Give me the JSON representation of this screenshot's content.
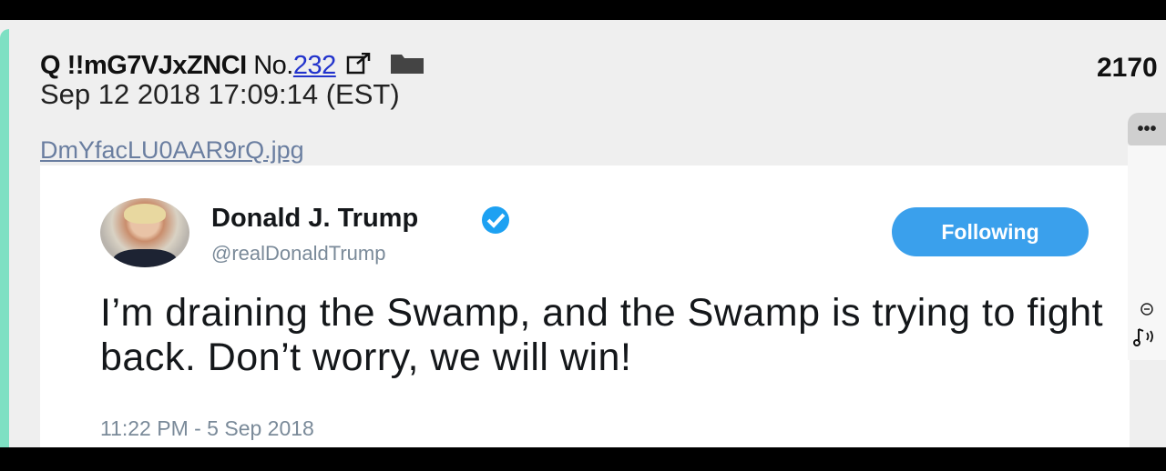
{
  "post": {
    "author_label": "Q",
    "tripcode": "!!mG7VJxZNCI",
    "number_prefix": "No.",
    "number": "232",
    "datetime": "Sep 12 2018 17:09:14 (EST)",
    "post_count": "2170",
    "filename": "DmYfacLU0AAR9rQ.jpg"
  },
  "tweet": {
    "author_name": "Donald J. Trump",
    "handle": "@realDonaldTrump",
    "follow_label": "Following",
    "text": "I’m draining the Swamp, and the Swamp is trying to fight back. Don’t worry, we will win!",
    "timestamp": "11:22 PM - 5 Sep 2018"
  },
  "side": {
    "menu_label": "•••"
  },
  "colors": {
    "accent": "#7ee0c3",
    "link": "#2233cc",
    "follow_button": "#3aa0ec",
    "verified": "#1da1f2"
  },
  "icons": [
    "external-link-icon",
    "folder-icon",
    "verified-icon",
    "more-icon",
    "minus-icon",
    "audio-icon"
  ]
}
